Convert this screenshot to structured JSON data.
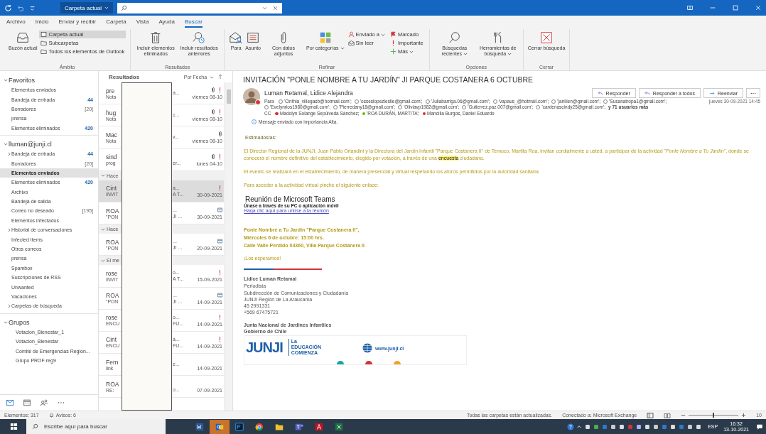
{
  "title_bar": {
    "scope": "Carpeta actual"
  },
  "menu_tabs": [
    {
      "label": "Archivo",
      "selected": false
    },
    {
      "label": "Inicio",
      "selected": false
    },
    {
      "label": "Enviar y recibir",
      "selected": false
    },
    {
      "label": "Carpeta",
      "selected": false
    },
    {
      "label": "Vista",
      "selected": false
    },
    {
      "label": "Ayuda",
      "selected": false
    },
    {
      "label": "Buscar",
      "selected": true
    }
  ],
  "ribbon": {
    "groups": [
      {
        "label": "Ámbito",
        "large": [
          {
            "label": "Buzón actual",
            "dropdown": false
          }
        ],
        "stacks": [
          [
            {
              "label": "Carpeta actual",
              "selected": true
            },
            {
              "label": "Subcarpetas",
              "selected": false
            },
            {
              "label": "Todos los elementos de Outlook",
              "selected": false
            }
          ]
        ]
      },
      {
        "label": "Resultados",
        "large": [
          {
            "label": "Incluir elementos eliminados",
            "dropdown": false
          },
          {
            "label": "Incluir resultados anteriores",
            "dropdown": false
          }
        ]
      },
      {
        "label": "Refinar",
        "large": [
          {
            "label": "Para",
            "dropdown": false
          },
          {
            "label": "Asunto",
            "dropdown": false
          },
          {
            "label": "Con datos adjuntos",
            "dropdown": false
          },
          {
            "label": "Por categorías",
            "dropdown": true
          }
        ],
        "stacks": [
          [
            {
              "label": "Enviado a",
              "dropdown": true
            },
            {
              "label": "Sin leer",
              "dropdown": false
            }
          ],
          [
            {
              "label": "Marcado",
              "dropdown": false
            },
            {
              "label": "Importante",
              "dropdown": false
            },
            {
              "label": "Más",
              "dropdown": true
            }
          ]
        ]
      },
      {
        "label": "Opciones",
        "large": [
          {
            "label": "Búsquedas recientes",
            "dropdown": true
          },
          {
            "label": "Herramientas de búsqueda",
            "dropdown": true
          }
        ]
      },
      {
        "label": "Cerrar",
        "large": [
          {
            "label": "Cerrar búsqueda",
            "dropdown": false
          }
        ]
      }
    ]
  },
  "sidebar": {
    "sections": [
      {
        "title": "Favoritos",
        "expanded": true,
        "items": [
          {
            "label": "Elementos enviados",
            "selected": false,
            "kind": "plain"
          },
          {
            "label": "Bandeja de entrada",
            "count": "44",
            "unread": true,
            "selected": false,
            "kind": "plain"
          },
          {
            "label": "Borradores",
            "count": "[20]",
            "unread": false,
            "selected": false,
            "kind": "plain"
          },
          {
            "label": "prensa",
            "selected": false,
            "kind": "plain"
          },
          {
            "label": "Elementos eliminados",
            "count": "420",
            "unread": true,
            "selected": false,
            "kind": "plain"
          }
        ]
      },
      {
        "title": "lluman@junji.cl",
        "expanded": true,
        "items": [
          {
            "label": "Bandeja de entrada",
            "count": "44",
            "unread": true,
            "selected": false,
            "kind": "collapsed"
          },
          {
            "label": "Borradores",
            "count": "[20]",
            "unread": false,
            "selected": false,
            "kind": "plain"
          },
          {
            "label": "Elementos enviados",
            "selected": true,
            "kind": "plain"
          },
          {
            "label": "Elementos eliminados",
            "count": "420",
            "unread": true,
            "selected": false,
            "kind": "plain"
          },
          {
            "label": "Archivo",
            "selected": false,
            "kind": "plain"
          },
          {
            "label": "Bandeja de salida",
            "selected": false,
            "kind": "plain"
          },
          {
            "label": "Correo no deseado",
            "count": "[195]",
            "unread": false,
            "selected": false,
            "kind": "plain"
          },
          {
            "label": "Elementos infectados",
            "selected": false,
            "kind": "plain"
          },
          {
            "label": "Historial de conversaciones",
            "selected": false,
            "kind": "collapsed"
          },
          {
            "label": "Infected Items",
            "selected": false,
            "kind": "plain"
          },
          {
            "label": "Otros correos",
            "selected": false,
            "kind": "plain"
          },
          {
            "label": "prensa",
            "selected": false,
            "kind": "plain"
          },
          {
            "label": "Spambox",
            "selected": false,
            "kind": "plain"
          },
          {
            "label": "Suscripciones de RSS",
            "selected": false,
            "kind": "plain"
          },
          {
            "label": "Unwanted",
            "selected": false,
            "kind": "plain"
          },
          {
            "label": "Vacaciones",
            "selected": false,
            "kind": "plain"
          },
          {
            "label": "Carpetas de búsqueda",
            "selected": false,
            "kind": "collapsed"
          }
        ]
      },
      {
        "title": "Grupos",
        "expanded": true,
        "items": [
          {
            "label": "Votacion_Bienestar_1",
            "selected": false,
            "kind": "group"
          },
          {
            "label": "Votacion_Bienestar",
            "selected": false,
            "kind": "group"
          },
          {
            "label": "Comité de Emergencias Región...",
            "selected": false,
            "kind": "group"
          },
          {
            "label": "Grupo PROF reg9",
            "selected": false,
            "kind": "group"
          }
        ]
      }
    ]
  },
  "message_list": {
    "title": "Resultados",
    "sort": "Por Fecha",
    "items": [
      {
        "kind": "message",
        "from": "pre",
        "preview": "Nota",
        "subject_end": "a...",
        "date": "viernes 08-10",
        "attachment": true,
        "important": true,
        "meeting": false,
        "selected": false
      },
      {
        "kind": "message",
        "from": "hug",
        "preview": "Nota",
        "subject_end": "c...",
        "date": "viernes 08-10",
        "attachment": true,
        "important": true,
        "meeting": false,
        "selected": false
      },
      {
        "kind": "message",
        "from": "Mac",
        "preview": "Nota",
        "subject_end": "v...",
        "date": "viernes 08-10",
        "attachment": true,
        "important": false,
        "meeting": false,
        "selected": false
      },
      {
        "kind": "message",
        "from": "sind",
        "preview": "prog",
        "preview_end": "er...",
        "date": "lunes 04-10",
        "attachment": true,
        "important": true,
        "meeting": false,
        "selected": false
      },
      {
        "kind": "group",
        "label": "Hace"
      },
      {
        "kind": "message",
        "from": "Cint",
        "preview": "INVIT",
        "subject_end": "a...",
        "preview_end": "A T...",
        "date": "30-09-2021",
        "attachment": false,
        "important": true,
        "meeting": false,
        "selected": true
      },
      {
        "kind": "message",
        "from": "ROA",
        "preview": "\"PON",
        "subject_end": "...",
        "preview_end": "JI ...",
        "date": "30-09-2021",
        "attachment": false,
        "important": false,
        "meeting": true,
        "selected": false
      },
      {
        "kind": "group",
        "label": "Hace"
      },
      {
        "kind": "message",
        "from": "ROA",
        "preview": "\"PON",
        "subject_end": "...",
        "preview_end": "JI ...",
        "date": "20-09-2021",
        "attachment": false,
        "important": false,
        "meeting": true,
        "selected": false
      },
      {
        "kind": "group",
        "label": "El me"
      },
      {
        "kind": "message",
        "from": "rose",
        "preview": "INVIT",
        "subject_end": "o...",
        "preview_end": "A T...",
        "date": "15-09-2021",
        "attachment": false,
        "important": true,
        "meeting": false,
        "selected": false
      },
      {
        "kind": "message",
        "from": "ROA",
        "preview": "\"PON",
        "subject_end": "...",
        "preview_end": "JI ...",
        "date": "14-09-2021",
        "attachment": false,
        "important": false,
        "meeting": true,
        "selected": false
      },
      {
        "kind": "message",
        "from": "rose",
        "preview": "ENCU",
        "subject_end": "o...",
        "preview_end": "FU...",
        "date": "14-09-2021",
        "attachment": false,
        "important": true,
        "meeting": false,
        "selected": false
      },
      {
        "kind": "message",
        "from": "Cint",
        "preview": "ENCU",
        "subject_end": "a...",
        "preview_end": "FU...",
        "date": "14-09-2021",
        "attachment": false,
        "important": true,
        "meeting": false,
        "selected": false
      },
      {
        "kind": "message",
        "from": "Fern",
        "preview": "link",
        "subject_end": "e...",
        "date": "14-09-2021",
        "attachment": false,
        "important": false,
        "meeting": false,
        "selected": false
      },
      {
        "kind": "message",
        "from": "ROA",
        "preview": "RE:",
        "preview_end": "o...",
        "date": "07-09-2021",
        "attachment": false,
        "important": false,
        "meeting": false,
        "selected": false
      }
    ]
  },
  "reading_pane": {
    "subject": "INVITACIÓN \"PONLE NOMBRE A TU JARDÍN\" JI PARQUE COSTANERA 6 OCTUBRE",
    "sender": {
      "name": "Luman Retamal, Lidice Alejandra",
      "color": "#d13438"
    },
    "actions": [
      {
        "label": "Responder"
      },
      {
        "label": "Responder a todos"
      },
      {
        "label": "Reenviar"
      }
    ],
    "date": "jueves 30-09-2021 14:45",
    "to_label": "Para",
    "to": [
      "'Cinthia_villegasb@hotmail.com';",
      "'osseslopezleslie@gmail.com';",
      "'Juliabarriga.06@gmail.com';",
      "'vapaus_@hotmail.com';",
      "'janilien@gmail.com';",
      "'Susanatropa1@gmail.com';",
      "'Evelynrios1980@gmail.com';",
      "'Pierredany18@gmail.com';",
      "'Oliviavp1982@gmail.com';",
      "'Gutierrez.paz.007@gmail.com';",
      "'cardenascindy25@gmail.com';"
    ],
    "to_more": "y 71 usuarios más",
    "cc_label": "CC",
    "cc": [
      {
        "name": "Madolyn Solange Sepúlveda Sánchez;",
        "color": "#d13438"
      },
      {
        "name": "'ROA DURÁN, MARTITA';",
        "color": "#6bb700"
      },
      {
        "name": "Mancilla Burgos, Daniel Eduardo",
        "color": "#d13438"
      }
    ],
    "info": "Mensaje enviado con importancia Alta.",
    "body": {
      "greeting": "Estimados/as:",
      "paragraphs": [
        [
          {
            "kind": "plain",
            "text": "El Director Regional de la JUNJI, Juan Pablo Orlandini y la Directora del Jardín Infantil \"Parque Costanera II\" de Temuco, Martita Roa, invitan cordialmente a usted, a participar de la actividad "
          },
          {
            "kind": "italic",
            "text": "\"Ponle Nombre a Tu Jardín\""
          },
          {
            "kind": "plain",
            "text": ", donde se conocerá el nombre definitivo del establecimiento, elegido por votación, a través de una "
          },
          {
            "kind": "highlight",
            "text": "encuesta"
          },
          {
            "kind": "plain",
            "text": " ciudadana."
          }
        ],
        [
          {
            "kind": "plain",
            "text": "El evento se realizará en el establecimiento, de manera presencial y virtual respetando los aforos permitidos por la autoridad sanitaria."
          }
        ],
        [
          {
            "kind": "plain",
            "text": "Para acceder a la actividad virtual pinche el siguiente enlace:"
          }
        ]
      ],
      "teams_title": "Reunión de Microsoft Teams",
      "teams_sub": "Únase a través de su PC o aplicación móvil",
      "teams_link": "Haga clic aquí para unirse a la reunión",
      "event_lines": [
        "Ponle Nombre a Tu Jardín \"Parque Costanera II\",",
        "Miércoles 6 de octubre: 15:00 hrs.",
        "Calle Valle Perdido 04360, Villa Parque Costanera II"
      ],
      "closing": "¡Los esperamos!"
    },
    "signature": {
      "name": "Lidice Luman Retamal",
      "lines": [
        "Periodista",
        "Subdirección de Comunicaciones y Ciudadanía",
        "JUNJI Región de La Araucanía",
        "45 2991331",
        "+569 67475721"
      ],
      "org": [
        "Junta Nacional de Jardines Infantiles",
        "Gobierno de Chile"
      ],
      "logo": {
        "brand": "JUNJI",
        "tagline": [
          "La",
          "EDUCACIÓN",
          "COMIENZA"
        ],
        "web": "www.junji.cl"
      }
    }
  },
  "status_bar": {
    "items": "Elementos: 317",
    "alerts": "Avisos: 6",
    "sync": "Todas las carpetas están actualizadas.",
    "connection": "Conectado a: Microsoft Exchange",
    "zoom": "10",
    "zoom_slider": {
      "level": 0.5
    }
  },
  "taskbar": {
    "search_placeholder": "Escribe aquí para buscar",
    "language": "ESP",
    "time": "16:32",
    "date": "13-10-2021"
  }
}
